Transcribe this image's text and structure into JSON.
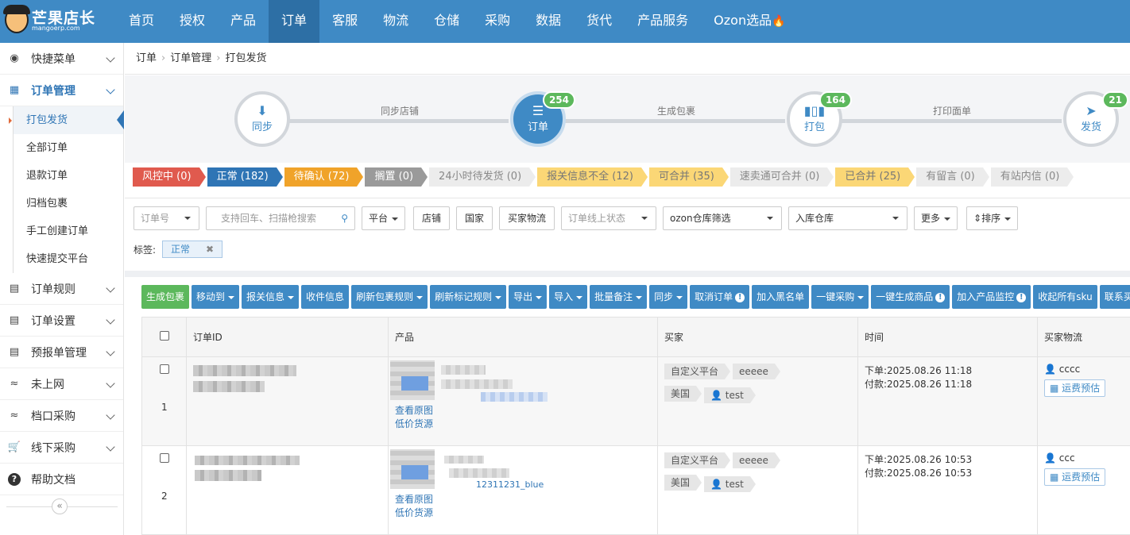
{
  "brand": {
    "name_cn": "芒果店长",
    "domain": "mangoerp.com"
  },
  "nav": [
    "首页",
    "授权",
    "产品",
    "订单",
    "客服",
    "物流",
    "仓储",
    "采购",
    "数据",
    "货代",
    "产品服务",
    "Ozon选品"
  ],
  "sidebar": {
    "groups": [
      "快捷菜单",
      "订单管理",
      "订单规则",
      "订单设置",
      "预报单管理",
      "未上网",
      "档口采购",
      "线下采购",
      "帮助文档"
    ],
    "sub": [
      "打包发货",
      "全部订单",
      "退款订单",
      "归档包裹",
      "手工创建订单",
      "快速提交平台"
    ],
    "collapse": "«"
  },
  "breadcrumb": [
    "订单",
    "订单管理",
    "打包发货"
  ],
  "flow": {
    "steps": [
      {
        "label": "同步",
        "badge": ""
      },
      {
        "label": "订单",
        "badge": "254"
      },
      {
        "label": "打包",
        "badge": "164"
      },
      {
        "label": "发货",
        "badge": "21"
      }
    ],
    "links": [
      "同步店铺",
      "生成包裹",
      "打印面单"
    ]
  },
  "status_tags": [
    "风控中 (0)",
    "正常 (182)",
    "待确认 (72)",
    "搁置 (0)",
    "24小时待发货 (0)",
    "报关信息不全 (12)",
    "可合并 (35)",
    "速卖通可合并 (0)",
    "已合并 (25)",
    "有留言 (0)",
    "有站内信 (0)"
  ],
  "filters": {
    "order_no": "订单号",
    "search_placeholder": "支持回车、扫描枪搜索",
    "platform": "平台",
    "shop": "店铺",
    "country": "国家",
    "buyer_logistics": "买家物流",
    "online_status": "订单线上状态",
    "ozon_wh": "ozon仓库筛选",
    "inbound_wh": "入库仓库",
    "more": "更多",
    "sort": "排序",
    "label_title": "标签:",
    "label_chip": "正常",
    "chip_x": "✖"
  },
  "actions": [
    "生成包裹",
    "移动到",
    "报关信息",
    "收件信息",
    "刷新包裹规则",
    "刷新标记规则",
    "导出",
    "导入",
    "批量备注",
    "同步",
    "取消订单",
    "加入黑名单",
    "一键采购",
    "一键生成商品",
    "加入产品监控",
    "收起所有sku",
    "联系买家"
  ],
  "table": {
    "headers": [
      "订单ID",
      "产品",
      "买家",
      "时间",
      "买家物流"
    ],
    "view_image": "查看原图",
    "low_price": "低价货源",
    "fee_btn": "运费预估",
    "rows": [
      {
        "index": "1",
        "platform": "自定义平台",
        "buyer_tag": "eeeee",
        "country": "美国",
        "buyer": "test",
        "order_time": "下单:2025.08.26 11:18",
        "pay_time": "付款:2025.08.26 11:18",
        "logistics": "cccc",
        "sku_note": ""
      },
      {
        "index": "2",
        "platform": "自定义平台",
        "buyer_tag": "eeeee",
        "country": "美国",
        "buyer": "test",
        "order_time": "下单:2025.08.26 10:53",
        "pay_time": "付款:2025.08.26 10:53",
        "logistics": "ccc",
        "sku_note": "12311231_blue"
      }
    ]
  }
}
